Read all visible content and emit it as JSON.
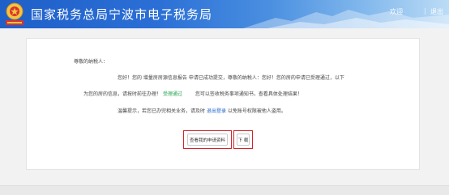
{
  "header": {
    "title": "国家税务总局宁波市电子税务局",
    "welcome": "欢迎",
    "separator": "|",
    "logout": "退出"
  },
  "notice": {
    "greeting": "尊敬的纳税人：",
    "line1": "您好！您的 增量房房源信息报告 申请已成功提交，尊敬的纳税人：您好！您的房的申请已受理通过，以下",
    "line2_a": "为您的房的信息，请按时前往办理！",
    "line2_link": "受理通过",
    "line2_b": "您可以签收税务事项通知书，查看具体处理结果！",
    "line3_a": "温馨提示，若您已办完相关业务，请及时",
    "line3_link": "退出登录",
    "line3_b": "以免账号权限被他人盗用。"
  },
  "actions": {
    "view_label": "查看我的申请资料",
    "download_label": "下 载"
  },
  "colors": {
    "accent": "#1f63c9",
    "success": "#21a34a",
    "highlight": "#d3232a"
  }
}
